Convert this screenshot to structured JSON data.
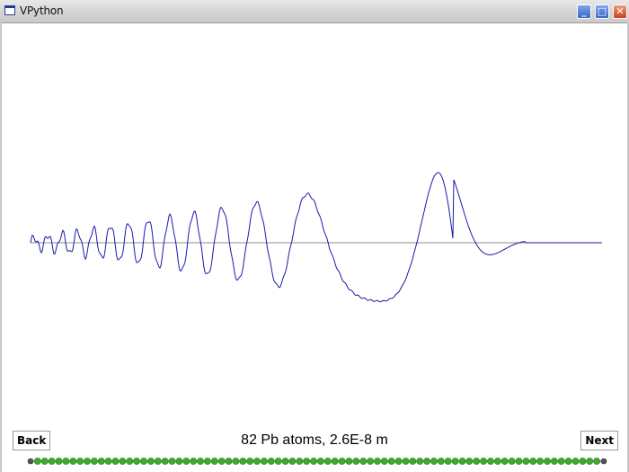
{
  "window": {
    "title": "VPython",
    "minimize_glyph": "_",
    "maximize_glyph": "□",
    "close_glyph": "✕"
  },
  "caption": "82 Pb atoms, 2.6E-8 m",
  "nav": {
    "back_label": "Back",
    "next_label": "Next"
  },
  "colors": {
    "curve": "#1a1aa8",
    "axis": "#8c8c8c",
    "step_dot": "#3dab2b",
    "end_dot": "#555555"
  },
  "progress": {
    "steps": 82,
    "current": 1
  }
}
